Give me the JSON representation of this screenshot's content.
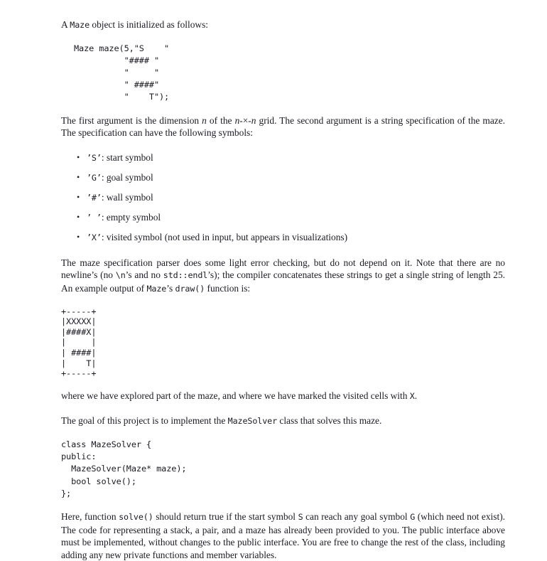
{
  "document": {
    "intro": {
      "prefix": "A ",
      "code": "Maze",
      "suffix": " object is initialized as follows:"
    },
    "init_code": "Maze maze(5,\"S    \"\n          \"#### \"\n          \"     \"\n          \" ####\"\n          \"    T\");",
    "argument_paragraph": {
      "part1": "The first argument is the dimension ",
      "math1": "n",
      "part2": " of the ",
      "math2": "n",
      "times": "-×-",
      "math3": "n",
      "part3": " grid. The second argument is a string specification of the maze. The specification can have the following symbols:"
    },
    "symbol_list": [
      {
        "bullet": "•",
        "symbol": "’S’",
        "description": ": start symbol"
      },
      {
        "bullet": "•",
        "symbol": "’G’",
        "description": ": goal symbol"
      },
      {
        "bullet": "•",
        "symbol": "’#’",
        "description": ": wall symbol"
      },
      {
        "bullet": "•",
        "symbol": "’ ’",
        "description": ": empty symbol"
      },
      {
        "bullet": "•",
        "symbol": "’X’",
        "description": ": visited symbol (not used in input, but appears in visualizations)"
      }
    ],
    "parser_paragraph": {
      "part1": "The maze specification parser does some light error checking, but do not depend on it. Note that there are no newline’s (no ",
      "code1": "\\n",
      "part2": "’s and no ",
      "code2": "std::endl",
      "part3": "’s); the compiler concatenates these strings to get a single string of length 25. An example output of ",
      "code3": "Maze",
      "part4": "’s ",
      "code4": "draw()",
      "part5": " function is:"
    },
    "maze_drawing": "+-----+\n|XXXXX|\n|####X|\n|     |\n| ####|\n|    T|\n+-----+",
    "explored_paragraph": {
      "part1": "where we have explored part of the maze, and where we have marked the visited cells with ",
      "code1": "X",
      "part2": "."
    },
    "goal_paragraph": {
      "part1": "The goal of this project is to implement the ",
      "code1": "MazeSolver",
      "part2": " class that solves this maze."
    },
    "class_code": "class MazeSolver {\npublic:\n  MazeSolver(Maze* maze);\n  bool solve();\n};",
    "final_paragraph": {
      "part1": "Here, function ",
      "code1": "solve()",
      "part2": " should return true if the start symbol ",
      "code2": "S",
      "part3": " can reach any goal symbol ",
      "code3": "G",
      "part4": " (which need not exist). The code for representing a stack, a pair, and a maze has already been provided to you. The public interface above must be implemented, without changes to the public interface. You are free to change the rest of the class, including adding any new private functions and member variables."
    }
  },
  "colors": {
    "text": "#1a1a22",
    "background": "#ffffff"
  }
}
